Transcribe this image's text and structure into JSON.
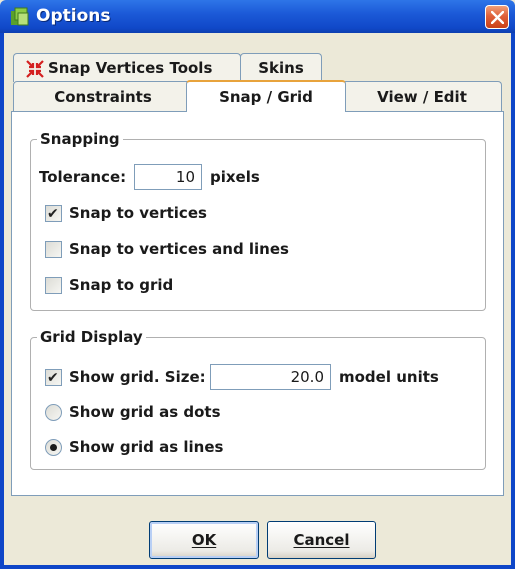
{
  "window": {
    "title": "Options",
    "icon": "options-app-icon",
    "close_icon": "close-icon"
  },
  "tabs": {
    "row1": [
      {
        "label": "Snap Vertices Tools",
        "icon": "snap-vertices-icon"
      },
      {
        "label": "Skins"
      }
    ],
    "row2": [
      {
        "label": "Constraints"
      },
      {
        "label": "Snap / Grid",
        "selected": true
      },
      {
        "label": "View / Edit"
      }
    ]
  },
  "snapping": {
    "title": "Snapping",
    "tolerance_label": "Tolerance:",
    "tolerance_value": "10",
    "tolerance_unit": "pixels",
    "snap_vertices": {
      "label": "Snap to vertices",
      "checked": true
    },
    "snap_vertices_lines": {
      "label": "Snap to vertices and lines",
      "checked": false
    },
    "snap_grid": {
      "label": "Snap to grid",
      "checked": false
    }
  },
  "grid_display": {
    "title": "Grid Display",
    "show_grid": {
      "label": "Show grid. Size:",
      "checked": true
    },
    "grid_size": "20.0",
    "grid_unit": "model units",
    "dots": {
      "label": "Show grid as dots",
      "selected": false
    },
    "lines": {
      "label": "Show grid as lines",
      "selected": true
    }
  },
  "buttons": {
    "ok": "OK",
    "cancel": "Cancel"
  },
  "colors": {
    "titlebar": "#1c5ad8",
    "close_button": "#e0603a",
    "selected_tab_accent": "#e8a33c",
    "dialog_bg": "#ece9d8"
  }
}
